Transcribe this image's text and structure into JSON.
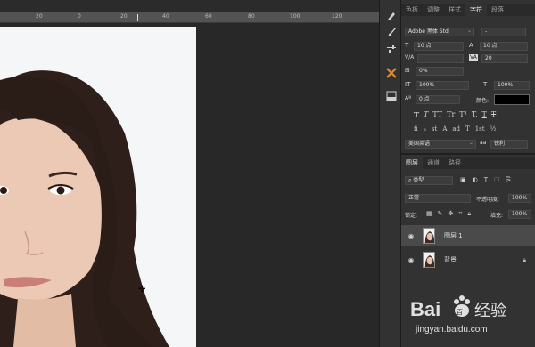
{
  "ruler": {
    "labels": [
      "20",
      "0",
      "20",
      "40",
      "60",
      "80",
      "100",
      "120"
    ]
  },
  "character_panel": {
    "tabs": [
      "色板",
      "调整",
      "样式",
      "字符",
      "段落"
    ],
    "active_tab": "字符",
    "font_family": "Adobe 黑体 Std",
    "font_style": "-",
    "font_size": "10 点",
    "leading": "10 点",
    "kerning_label": "V/A",
    "tracking": "20",
    "scale_percent": "0%",
    "vertical_scale": "100%",
    "horizontal_scale": "100%",
    "baseline_shift": "0 点",
    "color_label": "颜色:",
    "color_value": "#000000",
    "style_buttons": [
      "T",
      "T",
      "TT",
      "Tr",
      "T¹",
      "T,",
      "T",
      "T"
    ],
    "opentype_buttons": [
      "fi",
      "ℴ",
      "st",
      "A",
      "ad",
      "T",
      "1st",
      "½"
    ],
    "language": "美国英语",
    "aa_label": "aa",
    "antialias": "锐利"
  },
  "layers_panel": {
    "tabs": [
      "图层",
      "通道",
      "路径"
    ],
    "active_tab": "图层",
    "filter_kind": "类型",
    "blend_mode": "正常",
    "opacity_label": "不透明度:",
    "opacity": "100%",
    "lock_label": "锁定:",
    "fill_label": "填充:",
    "fill": "100%",
    "layers": [
      {
        "name": "图层 1",
        "selected": true,
        "locked": false
      },
      {
        "name": "背景",
        "selected": false,
        "locked": true
      }
    ]
  },
  "watermark": {
    "brand": "Bai",
    "brand2": "百",
    "brand3": "经验",
    "url": "jingyan.baidu.com"
  }
}
